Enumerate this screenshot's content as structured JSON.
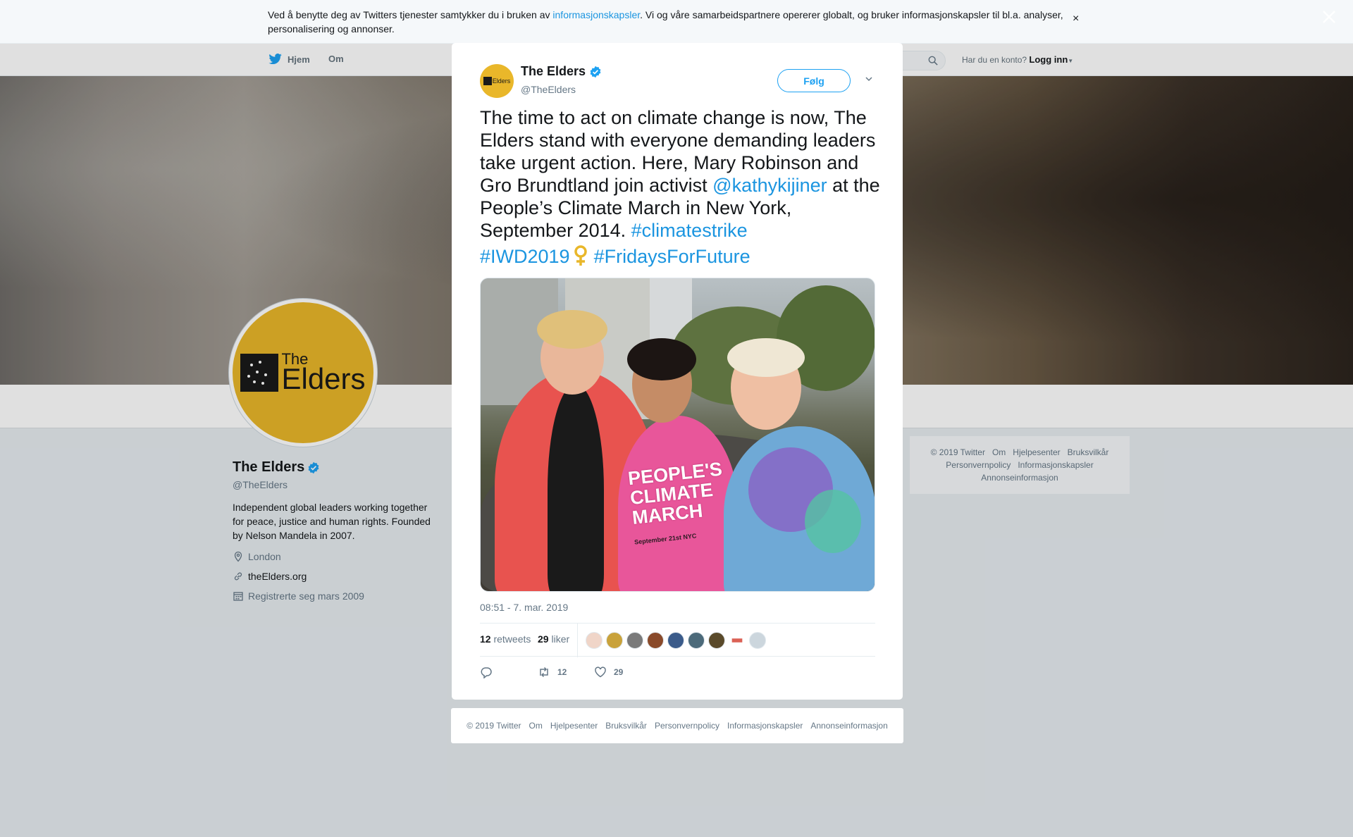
{
  "cookie_banner": {
    "text_before": "Ved å benytte deg av Twitters tjenester samtykker du i bruken av ",
    "link": "informasjonskapsler",
    "text_after": ". Vi og våre samarbeidspartnere opererer globalt, og bruker informasjonskapsler til bl.a. analyser, personalisering og annonser.",
    "close": "×"
  },
  "nav": {
    "home": "Hjem",
    "about": "Om",
    "login_prompt": "Har du en konto?",
    "login": "Logg inn"
  },
  "profile": {
    "name": "The Elders",
    "handle": "@TheElders",
    "bio": "Independent global leaders working together for peace, justice and human rights. Founded by Nelson Mandela in 2007.",
    "location": "London",
    "website": "theElders.org",
    "joined": "Registrerte seg mars 2009",
    "logo_the": "The",
    "logo_elders": "Elders"
  },
  "side_footer": {
    "links": [
      "© 2019 Twitter",
      "Om",
      "Hjelpesenter",
      "Bruksvilkår",
      "Personvernpolicy",
      "Informasjonskapsler",
      "Annonseinformasjon"
    ]
  },
  "tweet": {
    "author_name": "The Elders",
    "author_handle": "@TheElders",
    "avatar_text": "Elders",
    "follow": "Følg",
    "text_1": "The time to act on climate change is now, The Elders stand with everyone demanding leaders take urgent action. Here, Mary Robinson and Gro Brundtland join activist ",
    "mention": "@kathykijiner",
    "text_2": " at the People’s Climate March in New York, September 2014. ",
    "hashtag_1": "#climatestrike",
    "hashtag_2": "#IWD2019",
    "hashtag_3": "#FridaysForFuture",
    "photo_sign_text": "PEOPLE'S CLIMATE MARCH",
    "photo_sign_date": "September 21st  NYC",
    "timestamp": "08:51 - 7. mar. 2019",
    "retweets_count": "12",
    "retweets_label": "retweets",
    "likes_count": "29",
    "likes_label": "liker",
    "action_retweets": "12",
    "action_likes": "29"
  },
  "modal_footer": {
    "links": [
      "© 2019 Twitter",
      "Om",
      "Hjelpesenter",
      "Bruksvilkår",
      "Personvernpolicy",
      "Informasjonskapsler",
      "Annonseinformasjon"
    ]
  },
  "colors": {
    "link": "#1b95e0",
    "brand_yellow": "#e9b72a",
    "verified": "#1da1f2"
  },
  "icons": [
    "twitter-bird-icon",
    "search-icon",
    "close-icon",
    "verified-icon",
    "location-icon",
    "link-icon",
    "calendar-icon",
    "chevron-down-icon",
    "reply-icon",
    "retweet-icon",
    "like-icon",
    "female-sign-icon"
  ]
}
